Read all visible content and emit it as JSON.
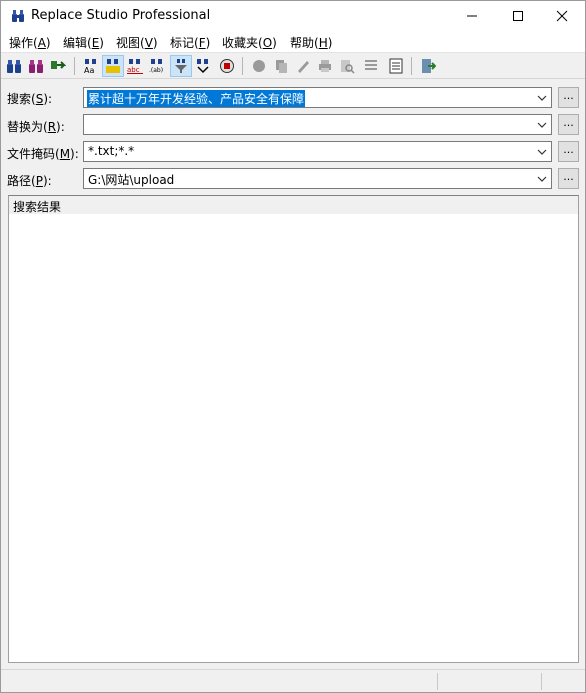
{
  "window": {
    "title": "Replace Studio Professional"
  },
  "menu": [
    {
      "label": "操作(",
      "key": "A",
      "end": ")"
    },
    {
      "label": "编辑(",
      "key": "E",
      "end": ")"
    },
    {
      "label": "视图(",
      "key": "V",
      "end": ")"
    },
    {
      "label": "标记(",
      "key": "F",
      "end": ")"
    },
    {
      "label": "收藏夹(",
      "key": "O",
      "end": ")"
    },
    {
      "label": "帮助(",
      "key": "H",
      "end": ")"
    }
  ],
  "toolbar": {
    "icons": [
      "binoculars-icon",
      "binoculars-double-icon",
      "replace-arrow-icon",
      "match-case-icon",
      "whole-word-icon",
      "abc-icon",
      "regex-icon",
      "funnel-icon",
      "search-subfolder-icon",
      "web-icon",
      "stop-icon",
      "copy-icon",
      "brush-icon",
      "print-icon",
      "preview-icon",
      "list-icon",
      "report-icon",
      "exit-icon"
    ]
  },
  "form": {
    "search": {
      "label_pre": "搜索(",
      "key": "S",
      "label_post": "):",
      "value": "累计超十万年开发经验、产品安全有保障"
    },
    "replace": {
      "label_pre": "替换为(",
      "key": "R",
      "label_post": "):",
      "value": ""
    },
    "mask": {
      "label_pre": "文件掩码(",
      "key": "M",
      "label_post": "):",
      "value": "*.txt;*.*"
    },
    "path": {
      "label_pre": "路径(",
      "key": "P",
      "label_post": "):",
      "value": "G:\\网站\\upload"
    },
    "browse_label": "..."
  },
  "results": {
    "header": "搜索结果"
  },
  "colors": {
    "selection": "#0078d7",
    "pressed": "#cce4f7"
  }
}
